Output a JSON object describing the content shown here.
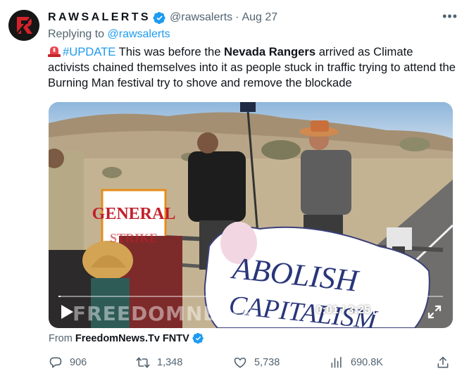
{
  "tweet": {
    "display_name": "RAWSALERTS",
    "handle": "@rawsalerts",
    "separator": "·",
    "date": "Aug 27",
    "more_label": "•••",
    "replying_to_prefix": "Replying to",
    "replying_to_handle": "@rawsalerts",
    "text": {
      "hashtag": "#UPDATE",
      "part1": " This was before the ",
      "bold": "Nevada Rangers",
      "part2": " arrived as Climate activists chained themselves into it as people stuck in traffic trying to attend the Burning Man festival try to shove and remove the blockade"
    }
  },
  "video": {
    "watermark": "FREEDOMNEWS",
    "sign_left": "GENERAL",
    "sign_left_partial": "STRIKE",
    "sign_right_line1": "ABOLISH",
    "sign_right_line2": "CAPITALISM",
    "current_time": "0:01",
    "duration": "3:25",
    "time_display": "0:01 / 3:25",
    "progress_fraction": 0.005
  },
  "source": {
    "prefix": "From",
    "name": "FreedomNews.Tv FNTV"
  },
  "actions": {
    "replies": "906",
    "retweets": "1,348",
    "likes": "5,738",
    "views": "690.8K"
  },
  "icons": {
    "avatar": "rawsalerts-logo",
    "verified": "verified-badge-icon",
    "siren": "rotating-light-emoji",
    "reply": "reply-icon",
    "retweet": "retweet-icon",
    "like": "heart-icon",
    "views": "views-chart-icon",
    "share": "share-icon"
  },
  "colors": {
    "accent": "#1d9bf0",
    "text": "#0f1419",
    "muted": "#536471"
  }
}
